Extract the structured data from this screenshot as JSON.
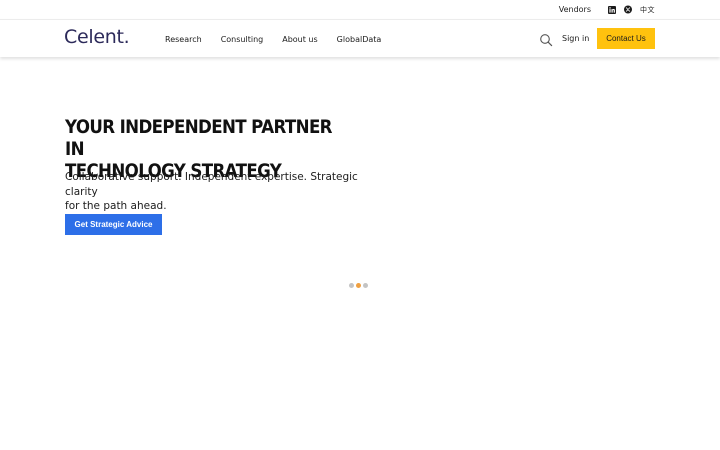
{
  "utility_bar": {
    "vendors_label": "Vendors",
    "socials": [
      {
        "icon": "linkedin-icon",
        "glyph": "in"
      },
      {
        "icon": "x-icon",
        "glyph": "𝕏"
      }
    ],
    "language_glyph": "中文"
  },
  "header": {
    "logo_text": "Celent.",
    "nav": [
      {
        "label": "Research"
      },
      {
        "label": "Consulting"
      },
      {
        "label": "About us"
      },
      {
        "label": "GlobalData"
      }
    ],
    "search_icon": "search-icon",
    "signin_label": "Sign in",
    "contact_label": "Contact Us"
  },
  "hero": {
    "title_line1": "YOUR INDEPENDENT PARTNER IN",
    "title_line2": "TECHNOLOGY STRATEGY",
    "subtitle_line1": "Collaborative support. Independent expertise. Strategic clarity",
    "subtitle_line2": "for the path ahead.",
    "cta_label": "Get Strategic Advice"
  },
  "carousel": {
    "dot_count": 3,
    "active_index": 1
  },
  "colors": {
    "brand_navy": "#2c2a5a",
    "accent_yellow": "#ffc20e",
    "cta_blue": "#2d6fe8",
    "dot_active": "#f0a040",
    "dot_inactive": "#c4c4c4"
  }
}
